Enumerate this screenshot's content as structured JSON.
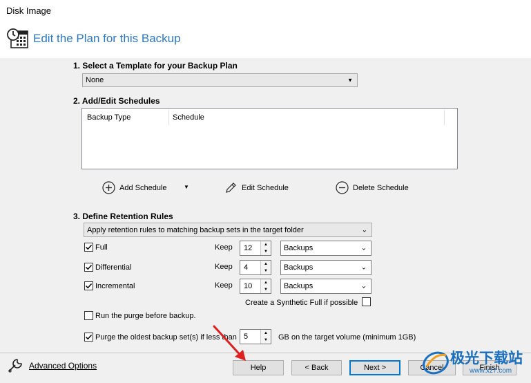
{
  "window": {
    "title": "Disk Image"
  },
  "header": {
    "title": "Edit the Plan for this Backup",
    "icon": "calendar-clock-icon"
  },
  "template": {
    "label": "1. Select a Template for your Backup Plan",
    "selected": "None"
  },
  "schedules": {
    "label": "2. Add/Edit Schedules",
    "columns": [
      "Backup Type",
      "Schedule"
    ],
    "actions": {
      "add": "Add Schedule",
      "edit": "Edit Schedule",
      "delete": "Delete Schedule"
    }
  },
  "retention": {
    "label": "3. Define Retention Rules",
    "mode": "Apply retention rules to matching backup sets in the target folder",
    "keep_label": "Keep",
    "rows": [
      {
        "name": "Full",
        "checked": true,
        "keep": "12",
        "unit": "Backups"
      },
      {
        "name": "Differential",
        "checked": true,
        "keep": "4",
        "unit": "Backups"
      },
      {
        "name": "Incremental",
        "checked": true,
        "keep": "10",
        "unit": "Backups"
      }
    ],
    "synthetic_full": {
      "label": "Create a Synthetic Full if possible",
      "checked": false
    },
    "purge_before": {
      "label": "Run the purge before backup.",
      "checked": false
    },
    "purge_oldest": {
      "label": "Purge the oldest backup set(s) if less than",
      "checked": true,
      "value": "5",
      "suffix": "GB on the target volume (minimum 1GB)"
    }
  },
  "footer": {
    "advanced": "Advanced Options",
    "help": "Help",
    "back": "< Back",
    "next": "Next >",
    "cancel": "Cancel",
    "finish": "Finish"
  },
  "watermark": {
    "text": "极光下载站",
    "url": "www.xz7.com"
  },
  "colors": {
    "accent": "#2b79c4",
    "primary_border": "#0078d7",
    "arrow": "#e02020"
  }
}
